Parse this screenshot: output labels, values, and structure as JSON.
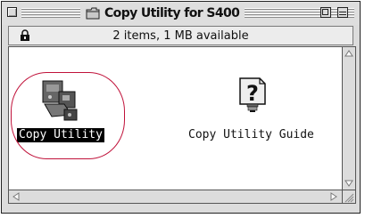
{
  "window": {
    "title": "Copy Utility for S400",
    "info": "2 items, 1 MB available"
  },
  "items": [
    {
      "label": "Copy Utility",
      "selected": true,
      "icon": "application-icon"
    },
    {
      "label": "Copy Utility Guide",
      "selected": false,
      "icon": "help-document-icon"
    }
  ],
  "annotation_color": "#c0123a"
}
